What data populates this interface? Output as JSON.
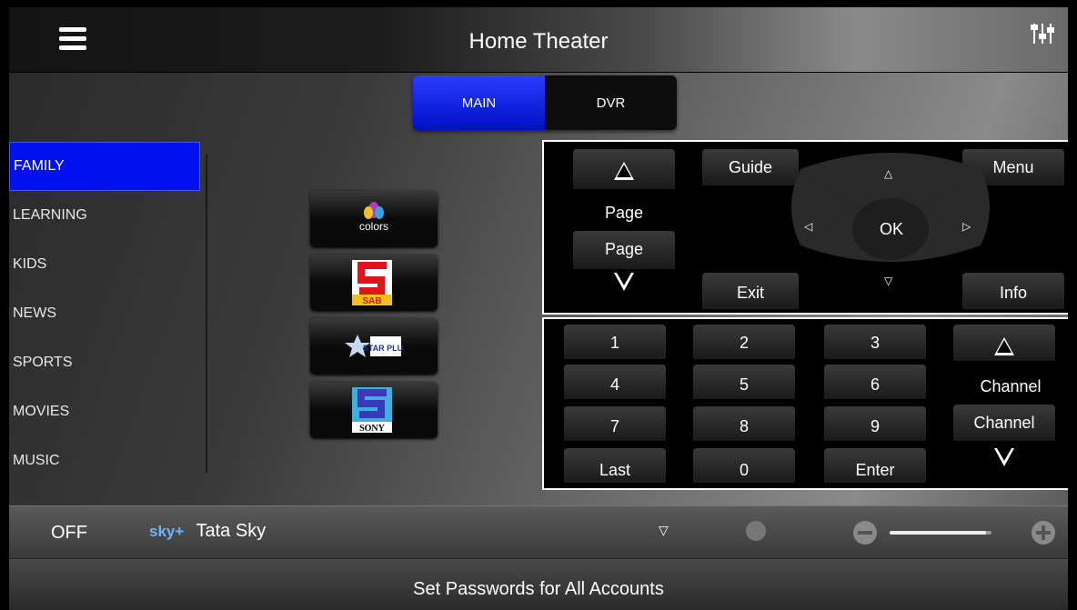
{
  "header": {
    "title": "Home Theater",
    "menu_icon": "hamburger-menu-icon",
    "settings_icon": "sliders-icon"
  },
  "tabs": [
    {
      "label": "MAIN",
      "active": true
    },
    {
      "label": "DVR",
      "active": false
    }
  ],
  "categories": [
    "FAMILY",
    "LEARNING",
    "KIDS",
    "NEWS",
    "SPORTS",
    "MOVIES",
    "MUSIC"
  ],
  "active_category": "FAMILY",
  "channels": [
    {
      "logo": "colors",
      "text": "colors"
    },
    {
      "logo": "sab",
      "text": "SAB"
    },
    {
      "logo": "starplus",
      "text": "STAR PLUS"
    },
    {
      "logo": "sony",
      "text": "SONY"
    }
  ],
  "nav_panel": {
    "page_up": "Page",
    "page_down": "Page",
    "guide": "Guide",
    "menu": "Menu",
    "ok": "OK",
    "exit": "Exit",
    "info": "Info",
    "up": "△",
    "down": "▽",
    "left": "◁",
    "right": "▷"
  },
  "keypad": {
    "rows": [
      [
        "1",
        "2",
        "3"
      ],
      [
        "4",
        "5",
        "6"
      ],
      [
        "7",
        "8",
        "9"
      ],
      [
        "Last",
        "0",
        "Enter"
      ]
    ],
    "channel_up": "Channel",
    "channel_down": "Channel"
  },
  "footer": {
    "power": "OFF",
    "source_brand": "sky+",
    "source_name": "Tata Sky",
    "source_arrow": "▽",
    "volume_level": 0.95
  },
  "bottom_bar": {
    "text": "Set Passwords for All Accounts"
  },
  "colors": {
    "active_blue": "#0010f0",
    "tab_blue": "#1a2ee0"
  }
}
